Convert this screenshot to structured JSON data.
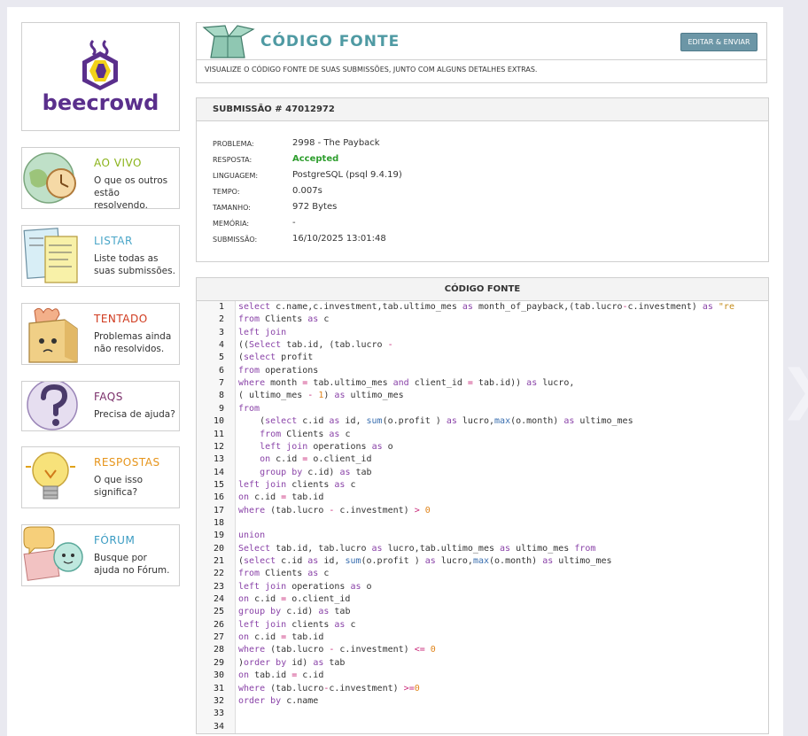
{
  "brand": {
    "name": "beecrowd"
  },
  "sidebar": {
    "items": [
      {
        "title": "AO VIVO",
        "desc": "O que os outros estão resolvendo.",
        "color": "#8ab31a",
        "icon": "globe-clock-icon"
      },
      {
        "title": "LISTAR",
        "desc": "Liste todas as suas submissões.",
        "color": "#4aa6c8",
        "icon": "notes-icon"
      },
      {
        "title": "TENTADO",
        "desc": "Problemas ainda não resolvidos.",
        "color": "#d03a1e",
        "icon": "box-character-icon"
      },
      {
        "title": "FAQS",
        "desc": "Precisa de ajuda?",
        "color": "#7a2f6a",
        "icon": "question-mark-icon"
      },
      {
        "title": "RESPOSTAS",
        "desc": "O que isso significa?",
        "color": "#e6941a",
        "icon": "lightbulb-icon"
      },
      {
        "title": "FÓRUM",
        "desc": "Busque por ajuda no Fórum.",
        "color": "#3a9bc2",
        "icon": "chat-bubbles-icon"
      }
    ]
  },
  "header": {
    "title": "CÓDIGO FONTE",
    "button": "EDITAR & ENVIAR",
    "subtitle": "VISUALIZE O CÓDIGO FONTE DE SUAS SUBMISSÕES, JUNTO COM ALGUNS DETALHES EXTRAS."
  },
  "submission": {
    "heading": "SUBMISSÃO # 47012972",
    "fields": [
      {
        "label": "PROBLEMA:",
        "value": "2998 - The Payback"
      },
      {
        "label": "RESPOSTA:",
        "value": "Accepted"
      },
      {
        "label": "LINGUAGEM:",
        "value": "PostgreSQL (psql 9.4.19)"
      },
      {
        "label": "TEMPO:",
        "value": "0.007s"
      },
      {
        "label": "TAMANHO:",
        "value": "972 Bytes"
      },
      {
        "label": "MEMÓRIA:",
        "value": "-"
      },
      {
        "label": "SUBMISSÃO:",
        "value": "16/10/2025 13:01:48"
      }
    ]
  },
  "code": {
    "heading": "CÓDIGO FONTE",
    "lines": [
      "select c.name,c.investment,tab.ultimo_mes as month_of_payback,(tab.lucro-c.investment) as \"re",
      "from Clients as c",
      "left join",
      "((Select tab.id, (tab.lucro -",
      "(select profit",
      "from operations",
      "where month = tab.ultimo_mes and client_id = tab.id)) as lucro,",
      "( ultimo_mes - 1) as ultimo_mes",
      "from",
      "    (select c.id as id, sum(o.profit ) as lucro,max(o.month) as ultimo_mes",
      "    from Clients as c",
      "    left join operations as o",
      "    on c.id = o.client_id",
      "    group by c.id) as tab",
      "left join clients as c",
      "on c.id = tab.id",
      "where (tab.lucro - c.investment) > 0",
      "",
      "union",
      "Select tab.id, tab.lucro as lucro,tab.ultimo_mes as ultimo_mes from",
      "(select c.id as id, sum(o.profit ) as lucro,max(o.month) as ultimo_mes",
      "from Clients as c",
      "left join operations as o",
      "on c.id = o.client_id",
      "group by c.id) as tab",
      "left join clients as c",
      "on c.id = tab.id",
      "where (tab.lucro - c.investment) <= 0",
      ")order by id) as tab",
      "on tab.id = c.id",
      "where (tab.lucro-c.investment) >=0",
      "order by c.name",
      "",
      ""
    ]
  }
}
